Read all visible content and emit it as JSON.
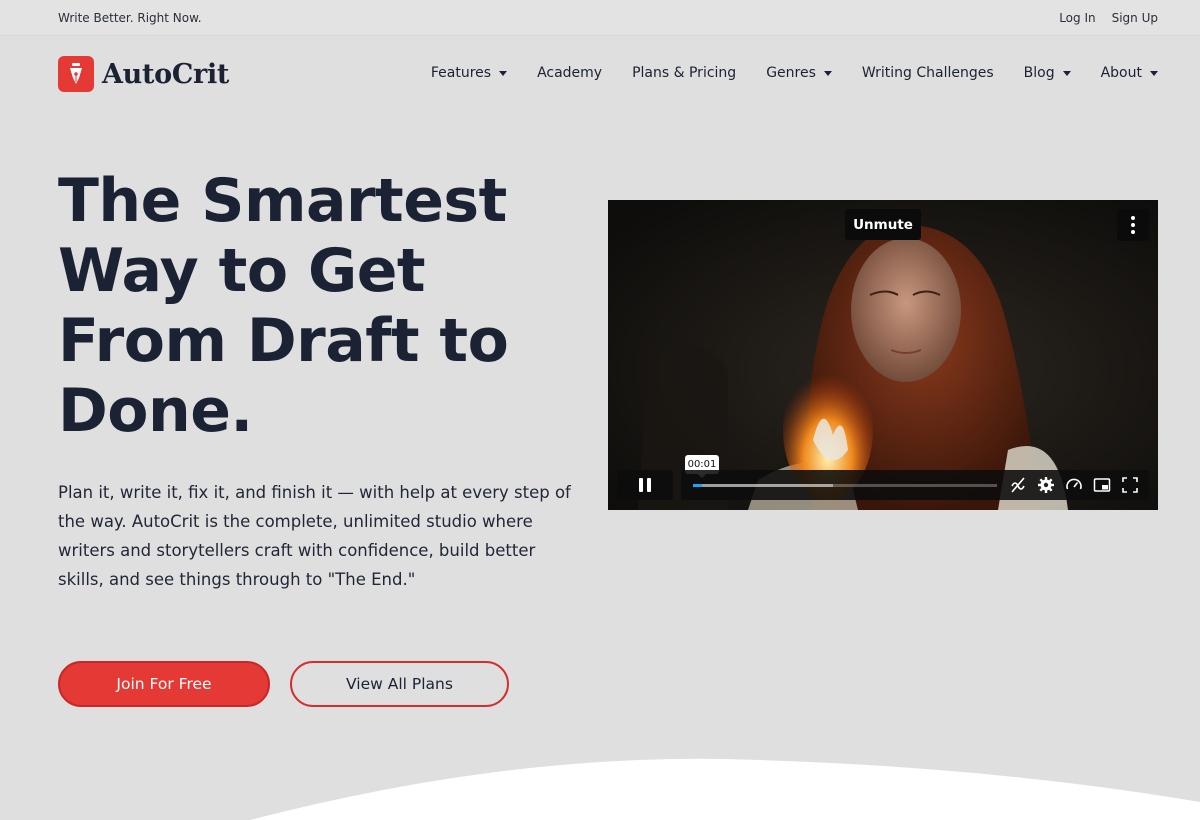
{
  "topbar": {
    "tagline": "Write Better. Right Now.",
    "login": "Log In",
    "signup": "Sign Up"
  },
  "brand": {
    "name": "AutoCrit",
    "accent": "#e53935",
    "logo_icon": "fountain-pen-nib-icon"
  },
  "nav": {
    "items": [
      {
        "label": "Features",
        "dropdown": true
      },
      {
        "label": "Academy",
        "dropdown": false
      },
      {
        "label": "Plans & Pricing",
        "dropdown": false
      },
      {
        "label": "Genres",
        "dropdown": true
      },
      {
        "label": "Writing Challenges",
        "dropdown": false
      },
      {
        "label": "Blog",
        "dropdown": true
      },
      {
        "label": "About",
        "dropdown": true
      }
    ]
  },
  "hero": {
    "title_lines": [
      "The Smartest",
      "Way to Get",
      "From Draft to",
      "Done."
    ],
    "description": "Plan it, write it, fix it, and finish it — with help at every step of the way. AutoCrit is the complete, unlimited studio where writers and storytellers craft with confidence, build better skills, and see things through to \"The End.\"",
    "primary_cta": "Join For Free",
    "secondary_cta": "View All Plans"
  },
  "video": {
    "unmute_label": "Unmute",
    "current_time": "00:01",
    "progress_played": 0.03,
    "progress_buffered": 0.46,
    "progress_color": "#1aa3ff",
    "control_icons": [
      "captions-off-icon",
      "settings-gear-icon",
      "speed-gauge-icon",
      "picture-in-picture-icon",
      "fullscreen-icon"
    ]
  }
}
